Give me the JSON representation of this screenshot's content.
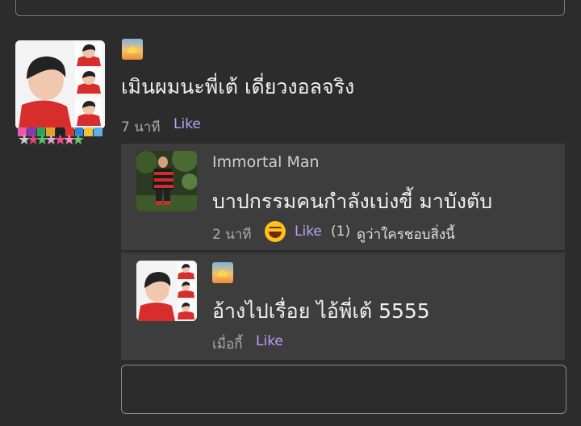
{
  "thread": {
    "main_comment": {
      "text": "เมินผมนะพี่เต้ เดี่ยวงอลจริง",
      "time": "7 นาที",
      "like_label": "Like",
      "badge_colors": [
        "#e85aa8",
        "#7b3fb0",
        "#27a65a",
        "#e0a32a",
        "#222222",
        "#d9362e",
        "#2a86d8",
        "#f0c43a",
        "#5ab0e8"
      ],
      "stars": "★★★★★★★"
    },
    "replies": [
      {
        "author": "Immortal Man",
        "text": "บาปกรรมคนกำลังเบ่งขี้ มาบังตับ",
        "time": "2 นาที",
        "reaction_icon": "laughing-emoji-icon",
        "like_label": "Like",
        "like_count": "(1)",
        "who_liked_label": "ดูว่าใครชอบสิ่งนี้"
      },
      {
        "text": "อ้างไปเรื่อย ไอ้พี่เต้ 5555",
        "time": "เมื่อกี้",
        "like_label": "Like"
      }
    ]
  }
}
